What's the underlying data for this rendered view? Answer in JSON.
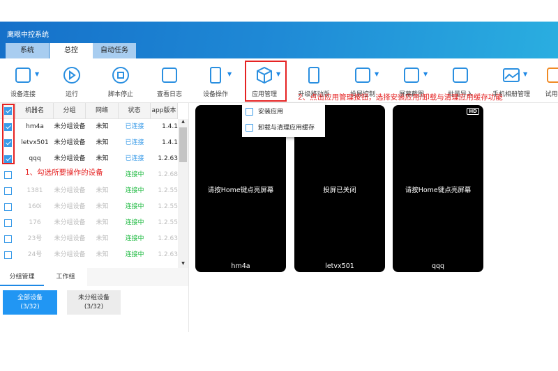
{
  "app": {
    "title": "鹰眼中控系统"
  },
  "tabs": [
    {
      "label": "系统"
    },
    {
      "label": "总控"
    },
    {
      "label": "自动任务"
    }
  ],
  "toolbar": [
    {
      "label": "设备连接",
      "icon": "device-connect-icon"
    },
    {
      "label": "运行",
      "icon": "play-icon"
    },
    {
      "label": "脚本停止",
      "icon": "stop-icon"
    },
    {
      "label": "查看日志",
      "icon": "log-search-icon"
    },
    {
      "label": "设备操作",
      "icon": "phone-icon"
    },
    {
      "label": "应用管理",
      "icon": "box-icon"
    },
    {
      "label": "升级移动版",
      "icon": "phone-upgrade-icon"
    },
    {
      "label": "投屏控制",
      "icon": "cast-icon"
    },
    {
      "label": "屏幕截图",
      "icon": "crop-icon"
    },
    {
      "label": "批量导入",
      "icon": "import-icon"
    },
    {
      "label": "手机相册管理",
      "icon": "image-icon"
    },
    {
      "label": "试用授",
      "icon": "trial-icon"
    }
  ],
  "app_menu": {
    "items": [
      {
        "label": "安装应用",
        "icon": "install-icon"
      },
      {
        "label": "卸载与清理应用缓存",
        "icon": "uninstall-icon"
      }
    ]
  },
  "table": {
    "headers": [
      "机器名",
      "分组",
      "网络",
      "状态",
      "app版本"
    ],
    "rows": [
      {
        "checked": true,
        "name": "hm4a",
        "group": "未分组设备",
        "network": "未知",
        "status": "已连接",
        "app": "1.4.1"
      },
      {
        "checked": true,
        "name": "letvx501",
        "group": "未分组设备",
        "network": "未知",
        "status": "已连接",
        "app": "1.4.1"
      },
      {
        "checked": true,
        "name": "qqq",
        "group": "未分组设备",
        "network": "未知",
        "status": "已连接",
        "app": "1.2.63"
      },
      {
        "checked": false,
        "name": "",
        "group": "",
        "network": "",
        "status": "连接中",
        "app": "1.2.68"
      },
      {
        "checked": false,
        "name": "1381",
        "group": "未分组设备",
        "network": "未知",
        "status": "连接中",
        "app": "1.2.55"
      },
      {
        "checked": false,
        "name": "160i",
        "group": "未分组设备",
        "network": "未知",
        "status": "连接中",
        "app": "1.2.55"
      },
      {
        "checked": false,
        "name": "176",
        "group": "未分组设备",
        "network": "未知",
        "status": "连接中",
        "app": "1.2.55"
      },
      {
        "checked": false,
        "name": "23号",
        "group": "未分组设备",
        "network": "未知",
        "status": "连接中",
        "app": "1.2.63"
      },
      {
        "checked": false,
        "name": "24号",
        "group": "未分组设备",
        "network": "未知",
        "status": "连接中",
        "app": "1.2.63"
      }
    ]
  },
  "bottom_tabs": [
    {
      "label": "分组管理"
    },
    {
      "label": "工作组"
    }
  ],
  "groups": [
    {
      "label": "全部设备",
      "count": "(3/32)"
    },
    {
      "label": "未分组设备",
      "count": "(3/32)"
    }
  ],
  "phones": [
    {
      "message": "请按Home键点亮屏幕",
      "name": "hm4a",
      "hd": ""
    },
    {
      "message": "投屏已关闭",
      "name": "letvx501",
      "hd": ""
    },
    {
      "message": "请按Home键点亮屏幕",
      "name": "qqq",
      "hd": "HD"
    }
  ],
  "annotations": {
    "step1": "1、勾选所要操作的设备",
    "step2": "2、点击应用管理按钮，选择安装应用/卸载与清理应用缓存功能"
  },
  "colors": {
    "accent": "#1e88e5",
    "annotation": "#e52222",
    "connected": "#3a9be8",
    "connecting": "#22bb44"
  }
}
